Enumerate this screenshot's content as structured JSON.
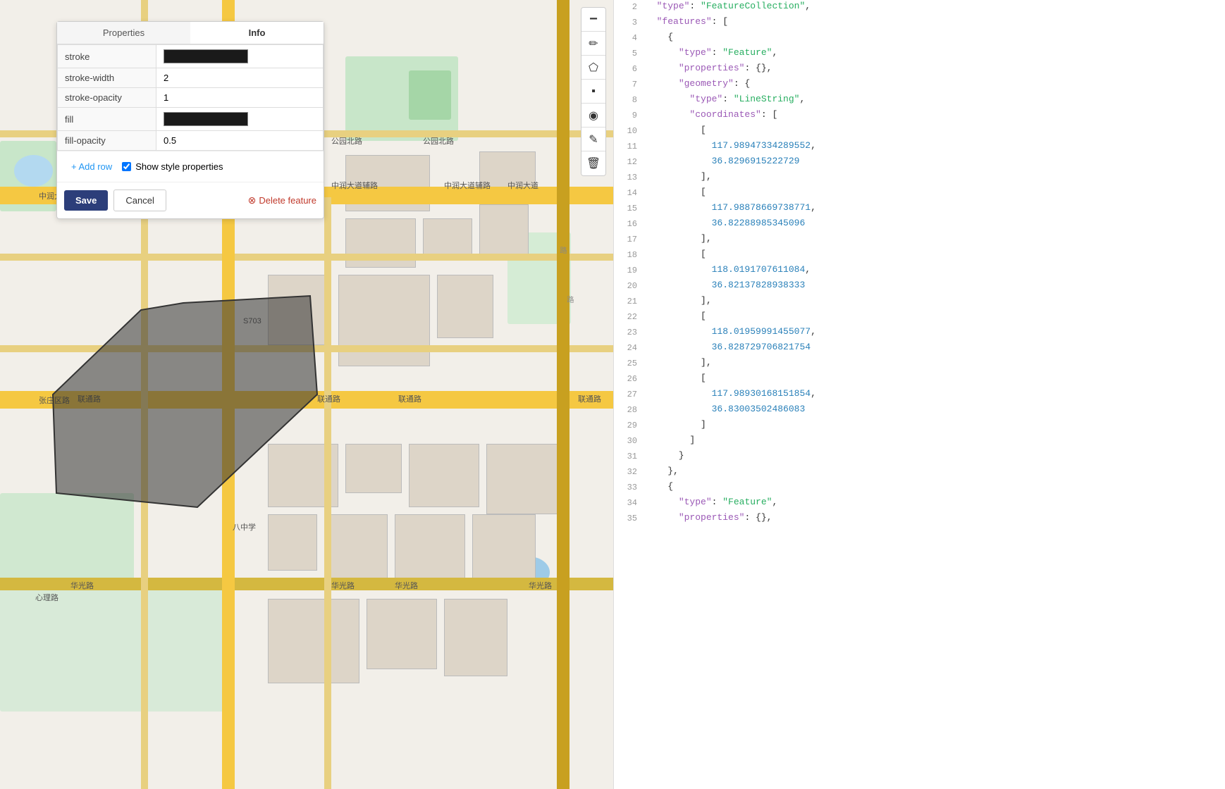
{
  "map": {
    "toolbar": {
      "buttons": [
        {
          "name": "minus-btn",
          "icon": "−",
          "interactable": true
        },
        {
          "name": "pencil-btn",
          "icon": "✏",
          "interactable": true
        },
        {
          "name": "pentagon-btn",
          "icon": "⬠",
          "interactable": true
        },
        {
          "name": "square-btn",
          "icon": "■",
          "interactable": true
        },
        {
          "name": "marker-btn",
          "icon": "◉",
          "interactable": true
        },
        {
          "name": "edit-btn",
          "icon": "✎",
          "interactable": true
        },
        {
          "name": "delete-btn",
          "icon": "🗑",
          "interactable": true
        }
      ]
    }
  },
  "properties_panel": {
    "tabs": [
      {
        "label": "Properties",
        "active": false
      },
      {
        "label": "Info",
        "active": true
      }
    ],
    "rows": [
      {
        "key": "stroke",
        "value_type": "color",
        "value": "#1a1a1a"
      },
      {
        "key": "stroke-width",
        "value_type": "text",
        "value": "2"
      },
      {
        "key": "stroke-opacity",
        "value_type": "text",
        "value": "1"
      },
      {
        "key": "fill",
        "value_type": "color",
        "value": "#1a1a1a"
      },
      {
        "key": "fill-opacity",
        "value_type": "text",
        "value": "0.5"
      }
    ],
    "add_row_label": "+ Add row",
    "show_style_label": "Show style properties",
    "buttons": {
      "save": "Save",
      "cancel": "Cancel",
      "delete": "Delete feature"
    }
  },
  "json_editor": {
    "lines": [
      {
        "num": 2,
        "content": [
          {
            "t": "  ",
            "c": "punc"
          },
          {
            "t": "\"type\"",
            "c": "key"
          },
          {
            "t": ": ",
            "c": "punc"
          },
          {
            "t": "\"FeatureCollection\"",
            "c": "str"
          },
          {
            "t": ",",
            "c": "punc"
          }
        ]
      },
      {
        "num": 3,
        "content": [
          {
            "t": "  ",
            "c": "punc"
          },
          {
            "t": "\"features\"",
            "c": "key"
          },
          {
            "t": ": [",
            "c": "punc"
          }
        ]
      },
      {
        "num": 4,
        "content": [
          {
            "t": "    {",
            "c": "punc"
          }
        ]
      },
      {
        "num": 5,
        "content": [
          {
            "t": "      ",
            "c": "punc"
          },
          {
            "t": "\"type\"",
            "c": "key"
          },
          {
            "t": ": ",
            "c": "punc"
          },
          {
            "t": "\"Feature\"",
            "c": "str"
          },
          {
            "t": ",",
            "c": "punc"
          }
        ]
      },
      {
        "num": 6,
        "content": [
          {
            "t": "      ",
            "c": "punc"
          },
          {
            "t": "\"properties\"",
            "c": "key"
          },
          {
            "t": ": {},",
            "c": "punc"
          }
        ]
      },
      {
        "num": 7,
        "content": [
          {
            "t": "      ",
            "c": "punc"
          },
          {
            "t": "\"geometry\"",
            "c": "key"
          },
          {
            "t": ": {",
            "c": "punc"
          }
        ]
      },
      {
        "num": 8,
        "content": [
          {
            "t": "        ",
            "c": "punc"
          },
          {
            "t": "\"type\"",
            "c": "key"
          },
          {
            "t": ": ",
            "c": "punc"
          },
          {
            "t": "\"LineString\"",
            "c": "str"
          },
          {
            "t": ",",
            "c": "punc"
          }
        ]
      },
      {
        "num": 9,
        "content": [
          {
            "t": "        ",
            "c": "punc"
          },
          {
            "t": "\"coordinates\"",
            "c": "key"
          },
          {
            "t": ": [",
            "c": "punc"
          }
        ]
      },
      {
        "num": 10,
        "content": [
          {
            "t": "          [",
            "c": "punc"
          }
        ]
      },
      {
        "num": 11,
        "content": [
          {
            "t": "            ",
            "c": "punc"
          },
          {
            "t": "117.98947334289552",
            "c": "num"
          },
          {
            "t": ",",
            "c": "punc"
          }
        ]
      },
      {
        "num": 12,
        "content": [
          {
            "t": "            ",
            "c": "punc"
          },
          {
            "t": "36.8296915222729",
            "c": "num"
          }
        ]
      },
      {
        "num": 13,
        "content": [
          {
            "t": "          ],",
            "c": "punc"
          }
        ]
      },
      {
        "num": 14,
        "content": [
          {
            "t": "          [",
            "c": "punc"
          }
        ]
      },
      {
        "num": 15,
        "content": [
          {
            "t": "            ",
            "c": "punc"
          },
          {
            "t": "117.98878669738771",
            "c": "num"
          },
          {
            "t": ",",
            "c": "punc"
          }
        ]
      },
      {
        "num": 16,
        "content": [
          {
            "t": "            ",
            "c": "punc"
          },
          {
            "t": "36.82288985345096",
            "c": "num"
          }
        ]
      },
      {
        "num": 17,
        "content": [
          {
            "t": "          ],",
            "c": "punc"
          }
        ]
      },
      {
        "num": 18,
        "content": [
          {
            "t": "          [",
            "c": "punc"
          }
        ]
      },
      {
        "num": 19,
        "content": [
          {
            "t": "            ",
            "c": "punc"
          },
          {
            "t": "118.0191707611084",
            "c": "num"
          },
          {
            "t": ",",
            "c": "punc"
          }
        ]
      },
      {
        "num": 20,
        "content": [
          {
            "t": "            ",
            "c": "punc"
          },
          {
            "t": "36.82137828938333",
            "c": "num"
          }
        ]
      },
      {
        "num": 21,
        "content": [
          {
            "t": "          ],",
            "c": "punc"
          }
        ]
      },
      {
        "num": 22,
        "content": [
          {
            "t": "          [",
            "c": "punc"
          }
        ]
      },
      {
        "num": 23,
        "content": [
          {
            "t": "            ",
            "c": "punc"
          },
          {
            "t": "118.01959991455077",
            "c": "num"
          },
          {
            "t": ",",
            "c": "punc"
          }
        ]
      },
      {
        "num": 24,
        "content": [
          {
            "t": "            ",
            "c": "punc"
          },
          {
            "t": "36.828729706821754",
            "c": "num"
          }
        ]
      },
      {
        "num": 25,
        "content": [
          {
            "t": "          ],",
            "c": "punc"
          }
        ]
      },
      {
        "num": 26,
        "content": [
          {
            "t": "          [",
            "c": "punc"
          }
        ]
      },
      {
        "num": 27,
        "content": [
          {
            "t": "            ",
            "c": "punc"
          },
          {
            "t": "117.98930168151854",
            "c": "num"
          },
          {
            "t": ",",
            "c": "punc"
          }
        ]
      },
      {
        "num": 28,
        "content": [
          {
            "t": "            ",
            "c": "punc"
          },
          {
            "t": "36.83003502486083",
            "c": "num"
          }
        ]
      },
      {
        "num": 29,
        "content": [
          {
            "t": "          ]",
            "c": "punc"
          }
        ]
      },
      {
        "num": 30,
        "content": [
          {
            "t": "        ]",
            "c": "punc"
          }
        ]
      },
      {
        "num": 31,
        "content": [
          {
            "t": "      }",
            "c": "punc"
          }
        ]
      },
      {
        "num": 32,
        "content": [
          {
            "t": "    },",
            "c": "punc"
          }
        ]
      },
      {
        "num": 33,
        "content": [
          {
            "t": "    {",
            "c": "punc"
          }
        ]
      },
      {
        "num": 34,
        "content": [
          {
            "t": "      ",
            "c": "punc"
          },
          {
            "t": "\"type\"",
            "c": "key"
          },
          {
            "t": ": ",
            "c": "punc"
          },
          {
            "t": "\"Feature\"",
            "c": "str"
          },
          {
            "t": ",",
            "c": "punc"
          }
        ]
      },
      {
        "num": 35,
        "content": [
          {
            "t": "      ",
            "c": "punc"
          },
          {
            "t": "\"properties\"",
            "c": "key"
          },
          {
            "t": ": {},",
            "c": "punc"
          }
        ]
      }
    ]
  }
}
